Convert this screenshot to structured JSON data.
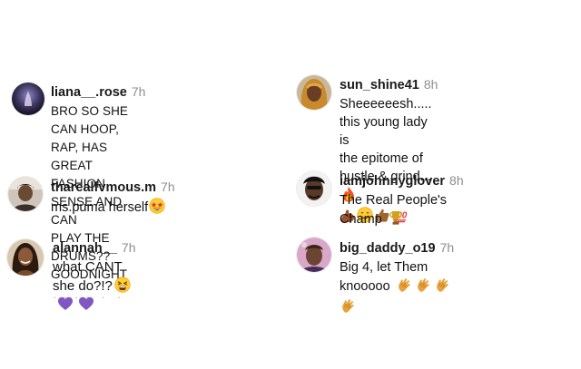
{
  "comments_left": [
    {
      "username": "liana__.rose",
      "time": "7h",
      "text_lines": [
        "BRO SO SHE CAN HOOP, RAP, HAS",
        "GREAT FASHION SENSE AND CAN",
        "PLAY THE DRUMS?? GOODNIGHT"
      ],
      "avatar_icon": "avatar-liana"
    },
    {
      "username": "tharealfvmous.m",
      "time": "7h",
      "text": "ms.puma herself",
      "emojis": [
        "star-struck-emoji"
      ],
      "avatar_icon": "avatar-tharealfvmous"
    },
    {
      "username": "alannah__",
      "time": "7h",
      "text": "what CANT she do?!?",
      "emojis": [
        "tired-face-emoji",
        "purple-heart-emoji",
        "purple-heart-emoji"
      ],
      "avatar_icon": "avatar-alannah"
    }
  ],
  "comments_right": [
    {
      "username": "sun_shine41",
      "time": "8h",
      "text_lines": [
        "Sheeeeeesh..... this young lady is",
        "the epitome of hustle & grind..."
      ],
      "line_end_emoji": "fire-emoji",
      "emojis": [
        "flexed-biceps-emoji",
        "smiling-face-emoji",
        "thumbs-up-emoji",
        "hundred-points-emoji"
      ],
      "avatar_icon": "avatar-sun-shine"
    },
    {
      "username": "iamjohnnyglover",
      "time": "8h",
      "text": "The Real People's Champ",
      "emojis": [
        "trophy-emoji"
      ],
      "avatar_icon": "avatar-johnnyglover"
    },
    {
      "username": "big_daddy_o19",
      "time": "7h",
      "text": "Big 4, let Them knooooo",
      "emojis": [
        "clapping-hands-emoji",
        "clapping-hands-emoji",
        "clapping-hands-emoji",
        "clapping-hands-emoji"
      ],
      "avatar_icon": "avatar-big-daddy"
    }
  ],
  "colors": {
    "username": "#1a1a1a",
    "timestamp": "#8e8e8e",
    "background": "#ffffff"
  }
}
